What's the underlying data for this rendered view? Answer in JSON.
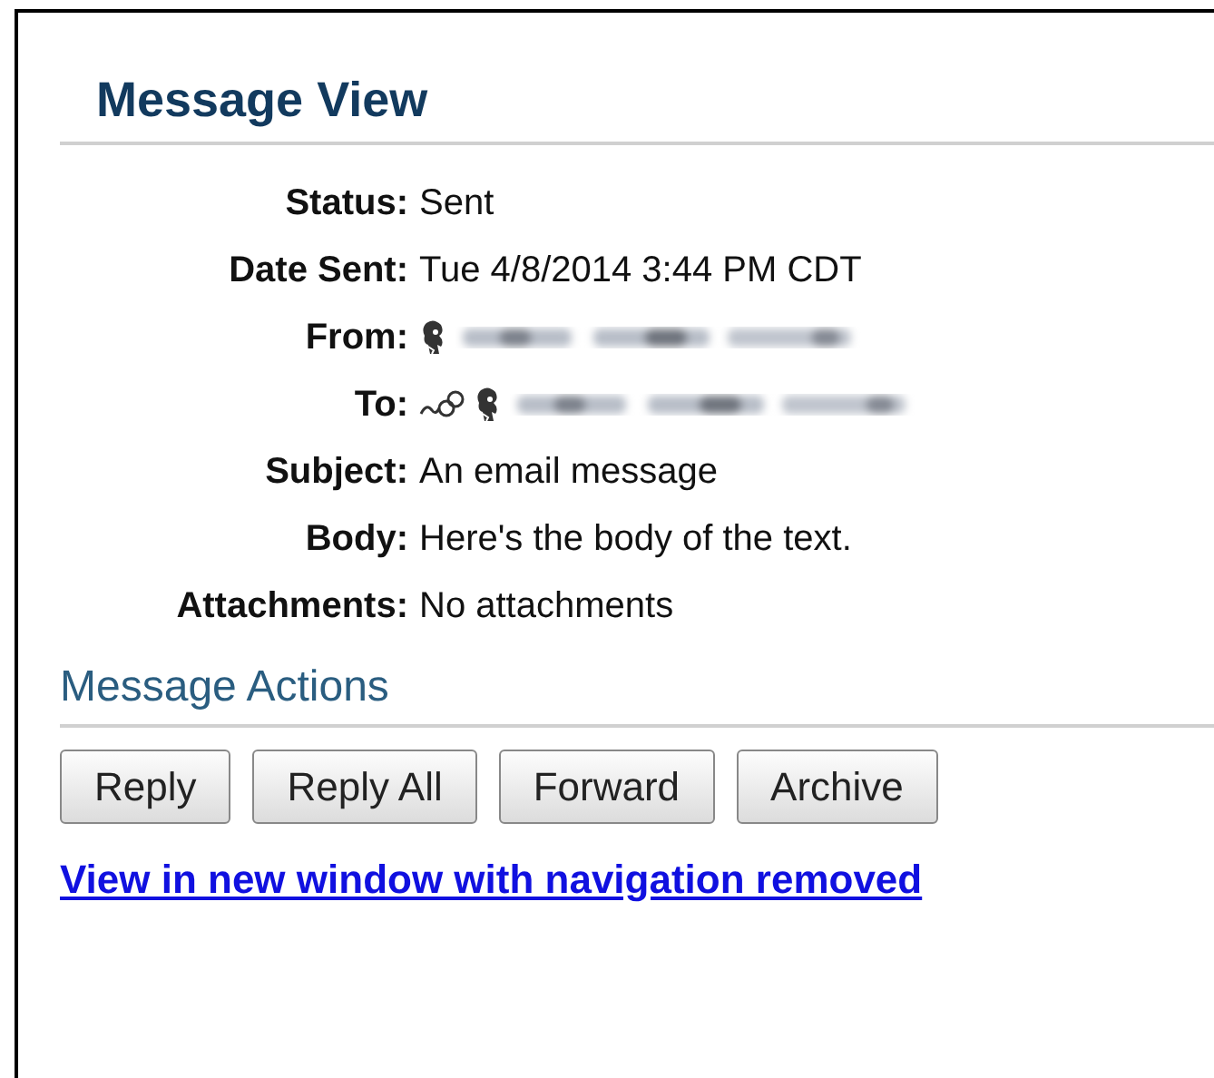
{
  "title": "Message View",
  "fields": [
    {
      "label": "Status:",
      "kind": "text",
      "value": "Sent"
    },
    {
      "label": "Date Sent:",
      "kind": "text",
      "value": "Tue 4/8/2014 3:44 PM CDT"
    },
    {
      "label": "From:",
      "kind": "person",
      "group_icon": false
    },
    {
      "label": "To:",
      "kind": "person",
      "group_icon": true
    },
    {
      "label": "Subject:",
      "kind": "text",
      "value": "An email message"
    },
    {
      "label": "Body:",
      "kind": "text",
      "value": "Here's the body of the text."
    },
    {
      "label": "Attachments:",
      "kind": "text",
      "value": "No attachments"
    }
  ],
  "actions_title": "Message Actions",
  "buttons": [
    "Reply",
    "Reply All",
    "Forward",
    "Archive"
  ],
  "link": "View in new window with navigation removed"
}
